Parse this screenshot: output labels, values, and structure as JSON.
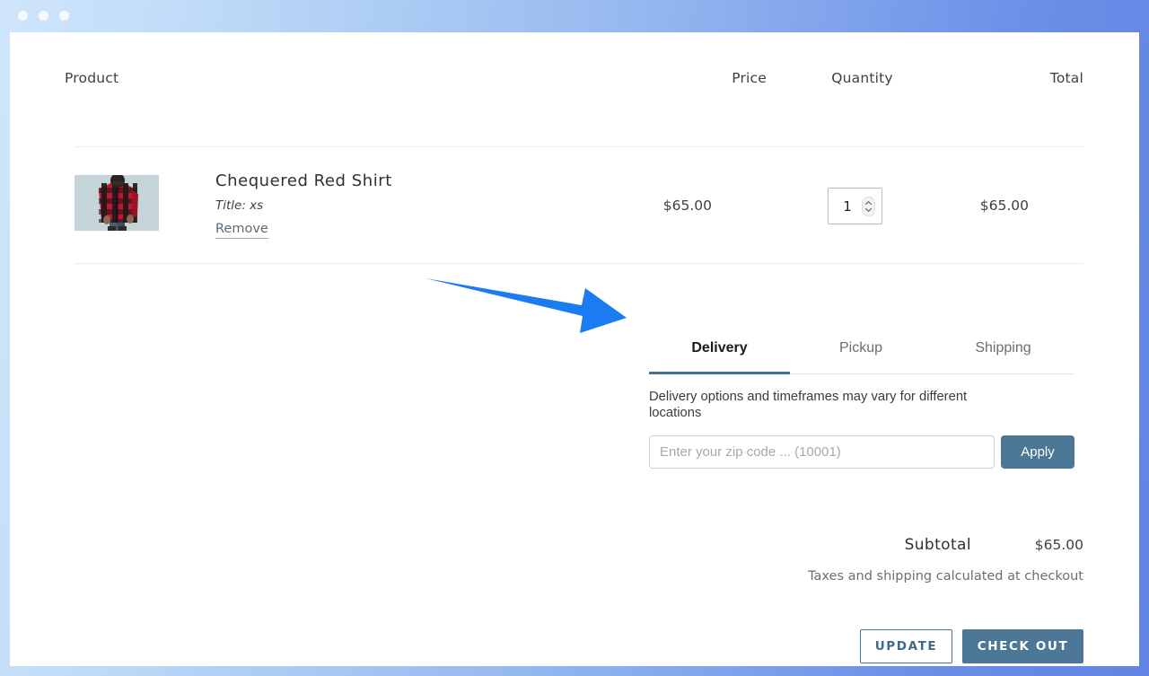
{
  "window": {
    "traffic_lights": [
      "close",
      "minimize",
      "maximize"
    ]
  },
  "cart": {
    "columns": {
      "product": "Product",
      "price": "Price",
      "quantity": "Quantity",
      "total": "Total"
    },
    "items": [
      {
        "title": "Chequered Red Shirt",
        "variant": "Title: xs",
        "remove_label": "Remove",
        "price": "$65.00",
        "quantity": "1",
        "total": "$65.00",
        "image_alt": "chequered-red-shirt-thumbnail"
      }
    ]
  },
  "delivery": {
    "tabs": [
      {
        "label": "Delivery",
        "active": true
      },
      {
        "label": "Pickup",
        "active": false
      },
      {
        "label": "Shipping",
        "active": false
      }
    ],
    "note": "Delivery options and timeframes may vary for different locations",
    "zip_placeholder": "Enter your zip code ... (10001)",
    "zip_value": "",
    "apply_label": "Apply"
  },
  "totals": {
    "subtotal_label": "Subtotal",
    "subtotal_value": "$65.00",
    "tax_note": "Taxes and shipping calculated at checkout"
  },
  "actions": {
    "update_label": "UPDATE",
    "checkout_label": "CHECK OUT"
  },
  "annotation": {
    "type": "arrow",
    "color": "#1a7cf0",
    "points_to": "delivery-tab"
  },
  "colors": {
    "accent": "#4c7796",
    "tab_underline": "#46708f",
    "arrow": "#1a7cf0",
    "link": "#5b6b77"
  }
}
